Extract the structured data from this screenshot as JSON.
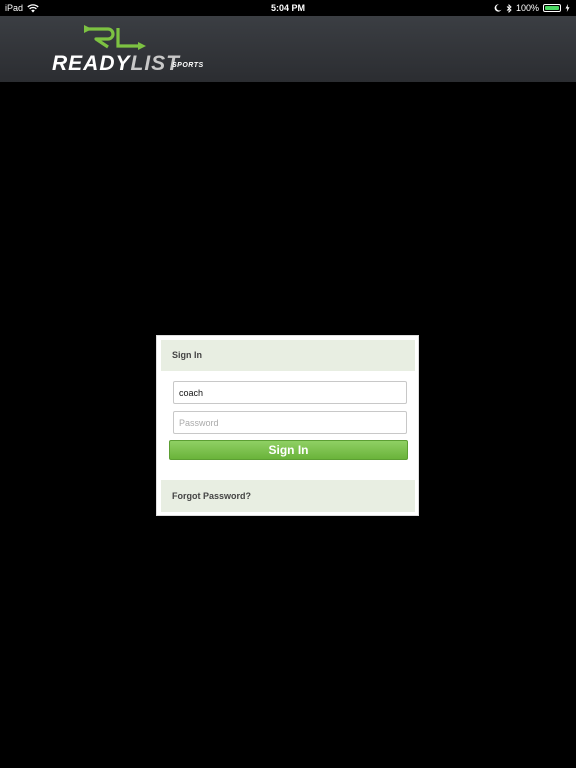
{
  "status_bar": {
    "device": "iPad",
    "time": "5:04 PM",
    "battery": "100%",
    "battery_level": 1.0,
    "icons": [
      "wifi-icon",
      "moon-icon",
      "bluetooth-icon",
      "battery-icon",
      "charging-icon"
    ]
  },
  "header": {
    "logo_mark": "RL",
    "logo_ready": "READY",
    "logo_list": "LIST",
    "logo_sub": "SPORTS",
    "accent_color": "#7dc242"
  },
  "login": {
    "title": "Sign In",
    "username_value": "coach",
    "password_placeholder": "Password",
    "button_label": "Sign In",
    "forgot_label": "Forgot Password?"
  },
  "colors": {
    "background": "#000000",
    "header": "#33363a",
    "panel_section": "#e8eee2",
    "button": "#7dc242"
  }
}
